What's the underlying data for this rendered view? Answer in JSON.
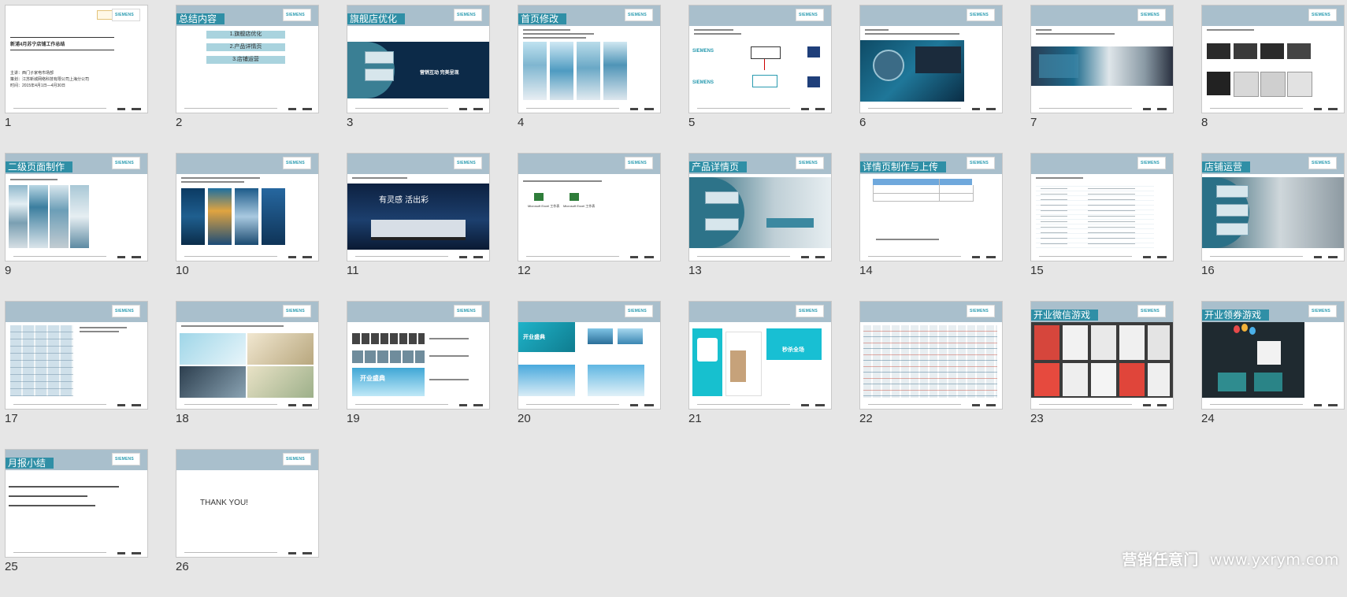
{
  "slides": [
    {
      "n": "1",
      "title": "新浦4月苏宁店铺工作总结",
      "lines": [
        "主讲：西门子家电市场部",
        "策划：江苏新城网络科技有限公司上海分公司",
        "时间：2015年4月1日—4月30日"
      ]
    },
    {
      "n": "2",
      "title": "总结内容",
      "items": [
        "1.旗舰店优化",
        "2.产品详情页",
        "3.店铺运营"
      ]
    },
    {
      "n": "3",
      "title": "旗舰店优化",
      "banner": "营销互动 完美呈现"
    },
    {
      "n": "4",
      "title": "首页修改"
    },
    {
      "n": "5",
      "title": ""
    },
    {
      "n": "6",
      "title": ""
    },
    {
      "n": "7",
      "title": ""
    },
    {
      "n": "8",
      "title": ""
    },
    {
      "n": "9",
      "title": "二级页面制作"
    },
    {
      "n": "10",
      "title": ""
    },
    {
      "n": "11",
      "title": "",
      "banner": "有灵感 活出彩"
    },
    {
      "n": "12",
      "title": "",
      "files": [
        "Microsoft Excel 工作表",
        "Microsoft Excel 工作表"
      ]
    },
    {
      "n": "13",
      "title": "产品详情页"
    },
    {
      "n": "14",
      "title": "详情页制作与上传"
    },
    {
      "n": "15",
      "title": ""
    },
    {
      "n": "16",
      "title": "店铺运营"
    },
    {
      "n": "17",
      "title": ""
    },
    {
      "n": "18",
      "title": ""
    },
    {
      "n": "19",
      "title": "",
      "banner": "开业盛典"
    },
    {
      "n": "20",
      "title": "",
      "banner": "开业盛典"
    },
    {
      "n": "21",
      "title": "",
      "promo": "秒杀全场"
    },
    {
      "n": "22",
      "title": ""
    },
    {
      "n": "23",
      "title": "开业微信游戏"
    },
    {
      "n": "24",
      "title": "开业领券游戏"
    },
    {
      "n": "25",
      "title": "月报小结"
    },
    {
      "n": "26",
      "title": "",
      "thanks": "THANK YOU!"
    }
  ],
  "brand": {
    "logo": "SIEMENS",
    "accent": "#2f8fa6",
    "header": "#a9bfcc"
  },
  "watermark": {
    "name": "营销任意门",
    "url": "www.yxrym.com"
  }
}
